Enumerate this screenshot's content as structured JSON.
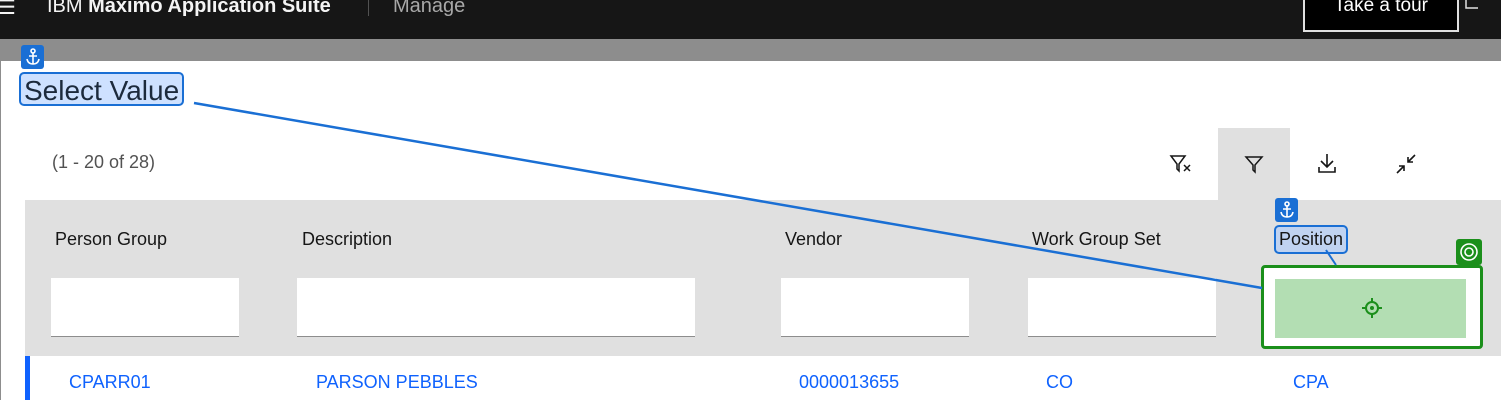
{
  "header": {
    "brand_prefix": "IBM",
    "brand_name": "Maximo Application Suite",
    "app_name": "Manage",
    "tour_button": "Take a tour",
    "menu_icon": "menu-icon",
    "side_icon": "clipboard-icon"
  },
  "dialog": {
    "title": "Select Value",
    "pagination": "(1 - 20 of 28)"
  },
  "toolbar": {
    "items": [
      {
        "icon": "clear-filter-icon",
        "active": false
      },
      {
        "icon": "filter-icon",
        "active": true
      },
      {
        "icon": "download-icon",
        "active": false
      },
      {
        "icon": "collapse-icon",
        "active": false
      }
    ]
  },
  "table": {
    "columns": [
      "Person Group",
      "Description",
      "Vendor",
      "Work Group Set",
      "Position"
    ],
    "filters": [
      "",
      "",
      "",
      "",
      ""
    ],
    "rows": [
      [
        "CPARR01",
        "PARSON PEBBLES",
        "0000013655",
        "CO",
        "CPA"
      ]
    ]
  },
  "annotations": {
    "anchor_color": "#1a6fd4",
    "target_color": "#1b8f1b",
    "anchor_icon": "anchor-icon",
    "target_icon": "target-icon",
    "crosshair_icon": "crosshair-icon"
  },
  "colors": {
    "link": "#0f62fe",
    "header_bg": "#161616",
    "table_head_bg": "#e0e0e0"
  }
}
